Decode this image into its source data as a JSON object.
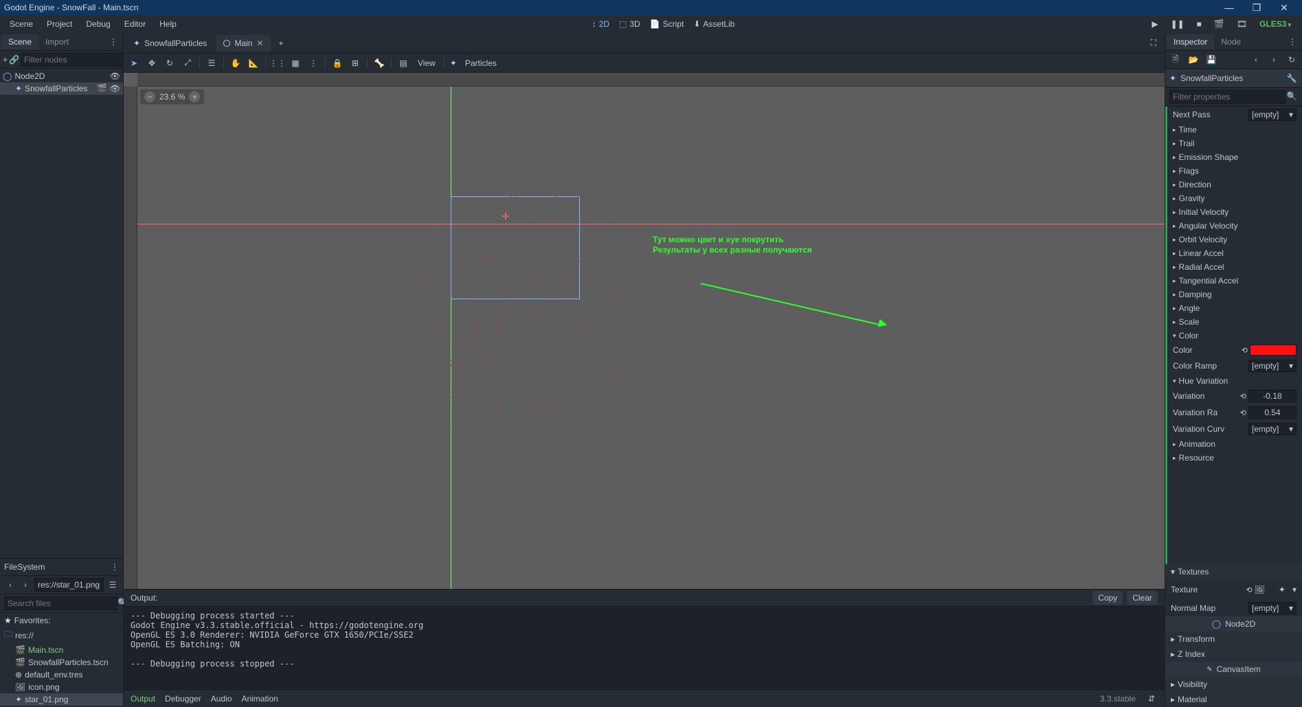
{
  "titlebar": {
    "title": "Godot Engine - SnowFall - Main.tscn"
  },
  "menu": {
    "scene": "Scene",
    "project": "Project",
    "debug": "Debug",
    "editor": "Editor",
    "help": "Help"
  },
  "workspace": {
    "d2": "2D",
    "d3": "3D",
    "script": "Script",
    "assetlib": "AssetLib"
  },
  "gles": "GLES3",
  "left_tabs": {
    "scene": "Scene",
    "import": "Import"
  },
  "scene_filter_ph": "Filter nodes",
  "scene_tree": {
    "root": "Node2D",
    "child": "SnowfallParticles"
  },
  "fs": {
    "title": "FileSystem",
    "path": "res://star_01.png",
    "search_ph": "Search files",
    "favorites": "Favorites:",
    "root": "res://",
    "files": [
      "Main.tscn",
      "SnowfallParticles.tscn",
      "default_env.tres",
      "icon.png",
      "star_01.png"
    ]
  },
  "scenetabs": {
    "t1": "SnowfallParticles",
    "t2": "Main"
  },
  "vptoolbar": {
    "view": "View",
    "particles": "Particles"
  },
  "zoom": "23.6 %",
  "annotation": {
    "l1": "Тут можно цвет и хуе покрутить",
    "l2": "Результаты у всех разные получаются"
  },
  "output": {
    "label": "Output:",
    "copy": "Copy",
    "clear": "Clear",
    "text": "--- Debugging process started ---\nGodot Engine v3.3.stable.official - https://godotengine.org\nOpenGL ES 3.0 Renderer: NVIDIA GeForce GTX 1650/PCIe/SSE2\nOpenGL ES Batching: ON\n\n--- Debugging process stopped ---"
  },
  "bottomtabs": {
    "output": "Output",
    "debugger": "Debugger",
    "audio": "Audio",
    "animation": "Animation",
    "version": "3.3.stable"
  },
  "inspector": {
    "tab_inspector": "Inspector",
    "tab_node": "Node",
    "node": "SnowfallParticles",
    "filter_ph": "Filter properties",
    "nextpass": "Next Pass",
    "empty": "[empty]",
    "groups": [
      "Time",
      "Trail",
      "Emission Shape",
      "Flags",
      "Direction",
      "Gravity",
      "Initial Velocity",
      "Angular Velocity",
      "Orbit Velocity",
      "Linear Accel",
      "Radial Accel",
      "Tangential Accel",
      "Damping",
      "Angle",
      "Scale"
    ],
    "color_group": "Color",
    "color_label": "Color",
    "color_ramp": "Color Ramp",
    "hue_group": "Hue Variation",
    "variation": "Variation",
    "variation_val": "-0.18",
    "variation_ra": "Variation Ra",
    "variation_ra_val": "0.54",
    "variation_curv": "Variation Curv",
    "animation": "Animation",
    "resource": "Resource",
    "textures": "Textures",
    "texture": "Texture",
    "normal_map": "Normal Map",
    "node2d": "Node2D",
    "transform": "Transform",
    "zindex": "Z Index",
    "canvasitem": "CanvasItem",
    "visibility": "Visibility",
    "material": "Material"
  }
}
